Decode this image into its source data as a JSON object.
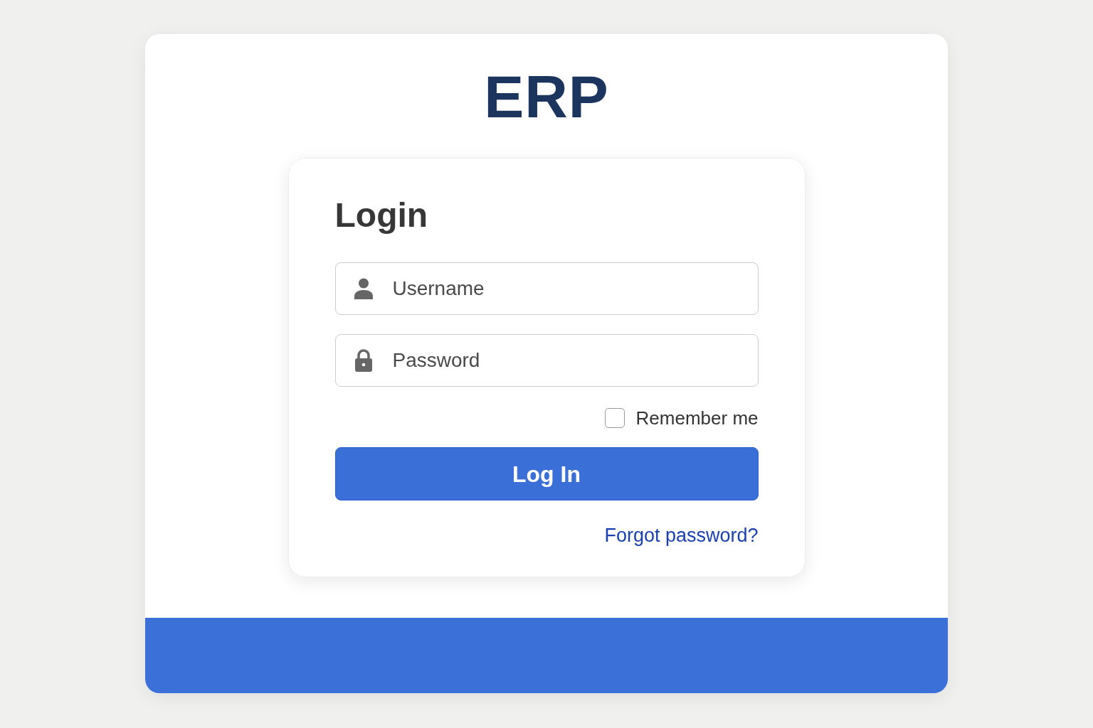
{
  "app_title": "ERP",
  "login": {
    "heading": "Login",
    "fields": [
      {
        "kind": "username",
        "placeholder": "Username"
      },
      {
        "kind": "password",
        "placeholder": "Password"
      }
    ],
    "remember": {
      "label": "Remember me",
      "checked": false
    },
    "submit": "Log In",
    "forgot_link": "Forgot password?"
  }
}
